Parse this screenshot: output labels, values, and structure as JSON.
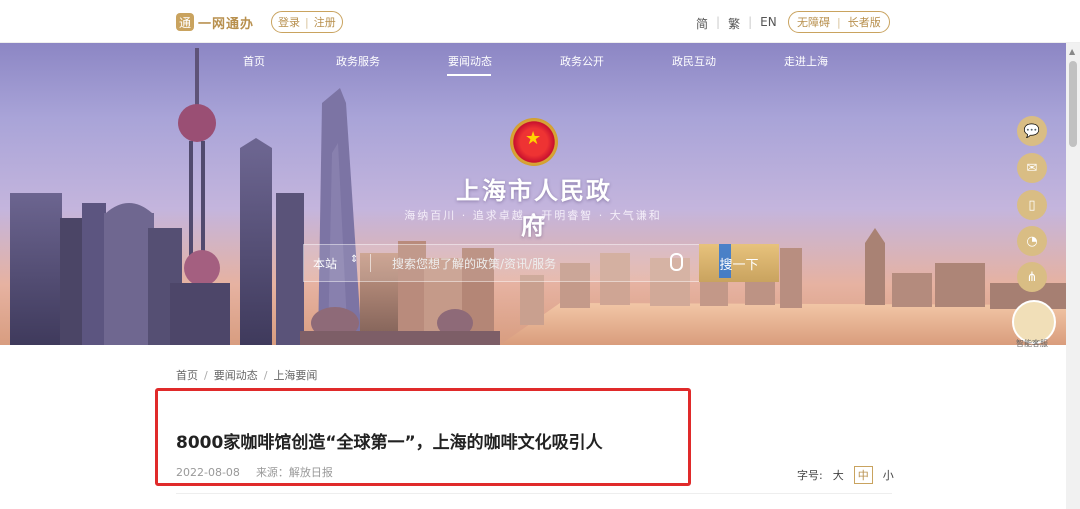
{
  "header": {
    "logo_text": "一网通办",
    "login": "登录",
    "register": "注册",
    "languages": [
      "简",
      "繁",
      "EN"
    ],
    "accessibility": "无障碍",
    "elder_mode": "长者版"
  },
  "nav": {
    "items": [
      "首页",
      "政务服务",
      "要闻动态",
      "政务公开",
      "政民互动",
      "走进上海"
    ],
    "active_index": 2
  },
  "banner": {
    "title": "上海市人民政府",
    "motto": "海纳百川 · 追求卓越 · 开明睿智 · 大气谦和"
  },
  "search": {
    "scope": "本站",
    "placeholder": "搜索您想了解的政策/资讯/服务",
    "button": "搜一下"
  },
  "float_buttons": [
    "wechat-icon",
    "mail-icon",
    "mobile-icon",
    "rss-icon",
    "share-icon"
  ],
  "assistant_label": "智能客服",
  "breadcrumb": [
    "首页",
    "要闻动态",
    "上海要闻"
  ],
  "article": {
    "title": "8000家咖啡馆创造“全球第一”，上海的咖啡文化吸引人",
    "date": "2022-08-08",
    "source": "来源：解放日报"
  },
  "font_size": {
    "label": "字号:",
    "options": [
      "大",
      "中",
      "小"
    ],
    "selected": "中"
  },
  "colors": {
    "accent": "#c9a35f",
    "highlight": "#e02a2a"
  }
}
